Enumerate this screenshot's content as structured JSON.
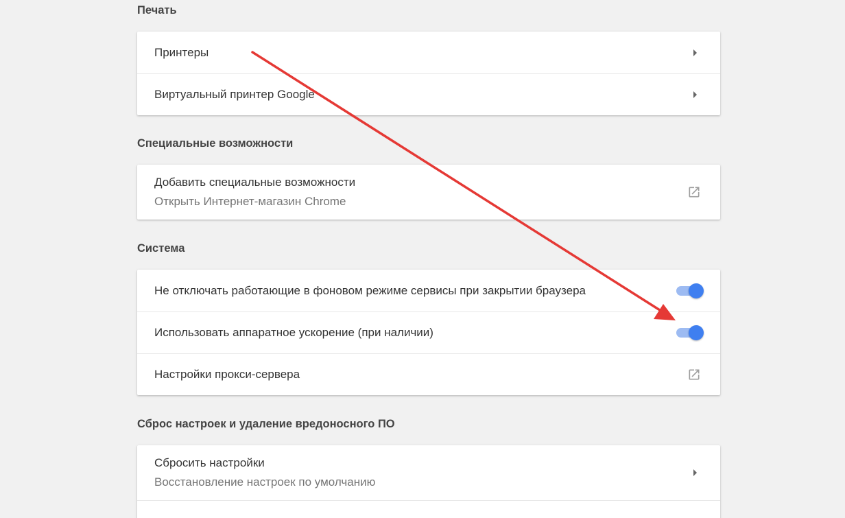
{
  "sections": {
    "printing": {
      "title": "Печать",
      "items": [
        {
          "label": "Принтеры"
        },
        {
          "label": "Виртуальный принтер Google"
        }
      ]
    },
    "accessibility": {
      "title": "Специальные возможности",
      "items": [
        {
          "label": "Добавить специальные возможности",
          "sublabel": "Открыть Интернет-магазин Chrome"
        }
      ]
    },
    "system": {
      "title": "Система",
      "items": [
        {
          "label": "Не отключать работающие в фоновом режиме сервисы при закрытии браузера",
          "toggle": true
        },
        {
          "label": "Использовать аппаратное ускорение (при наличии)",
          "toggle": true
        },
        {
          "label": "Настройки прокси-сервера"
        }
      ]
    },
    "reset": {
      "title": "Сброс настроек и удаление вредоносного ПО",
      "items": [
        {
          "label": "Сбросить настройки",
          "sublabel": "Восстановление настроек по умолчанию"
        }
      ]
    }
  },
  "colors": {
    "background": "#f1f1f1",
    "card": "#ffffff",
    "toggle_knob": "#3f7ff0",
    "toggle_track": "#9dbbf2",
    "annotation_arrow": "#e53935"
  },
  "icons": {
    "submenu": "arrow-right-icon",
    "external": "open-in-new-icon"
  }
}
